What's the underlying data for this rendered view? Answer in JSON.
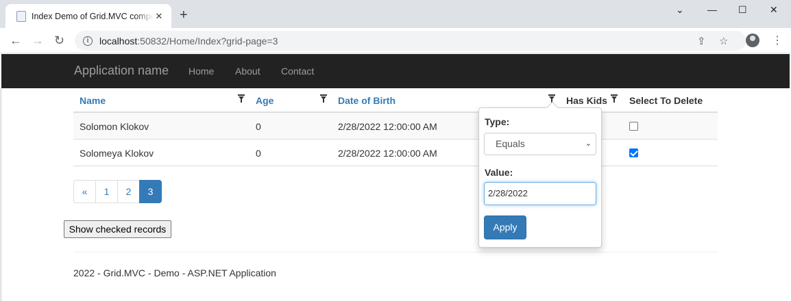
{
  "browser": {
    "tab_title": "Index Demo of Grid.MVC component",
    "tab_close": "✕",
    "new_tab": "+",
    "url_host": "localhost",
    "url_path": ":50832/Home/Index?grid-page=3",
    "back": "←",
    "forward": "→",
    "reload": "↻",
    "info": "i",
    "share": "⇪",
    "bookmark": "☆",
    "menu": "⋮",
    "minimize": "—",
    "maximize": "☐",
    "close": "✕",
    "tab_list": "⌄"
  },
  "navbar": {
    "brand": "Application name",
    "links": [
      "Home",
      "About",
      "Contact"
    ]
  },
  "grid": {
    "headers": {
      "name": "Name",
      "age": "Age",
      "dob": "Date of Birth",
      "has_kids": "Has Kids",
      "select": "Select To Delete"
    },
    "rows": [
      {
        "name": "Solomon Klokov",
        "age": "0",
        "dob": "2/28/2022 12:00:00 AM",
        "selected": false
      },
      {
        "name": "Solomeya Klokov",
        "age": "0",
        "dob": "2/28/2022 12:00:00 AM",
        "selected": true
      }
    ]
  },
  "pagination": {
    "prev": "«",
    "pages": [
      "1",
      "2",
      "3"
    ],
    "active_page": "3"
  },
  "show_checked_label": "Show checked records",
  "filter_popup": {
    "type_label": "Type:",
    "type_value": "Equals",
    "value_label": "Value:",
    "value": "2/28/2022",
    "apply_label": "Apply"
  },
  "footer": "2022 - Grid.MVC - Demo - ASP.NET Application",
  "colors": {
    "link": "#337ab7",
    "navbar": "#222222",
    "active_page": "#337ab7"
  }
}
